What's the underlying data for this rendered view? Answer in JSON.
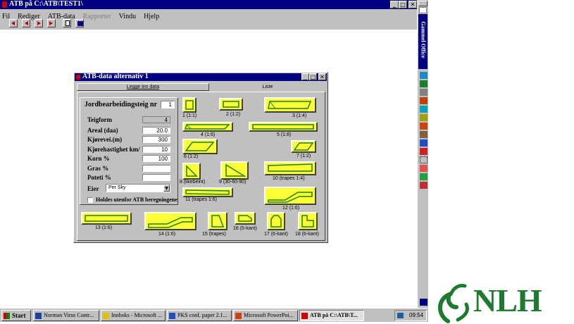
{
  "app": {
    "title": "ATB på C:\\ATB\\TEST1\\",
    "menu": [
      "Fil",
      "Rediger",
      "ATB-data",
      "Rapporter",
      "Vindu",
      "Hjelp"
    ],
    "menu_disabled_index": 3
  },
  "dialog": {
    "title": "ATB-data alternativ 1",
    "tabs": [
      "Legge inn data",
      "Liste"
    ],
    "teig_label": "Jordbearbeidingsteig nr",
    "teig_value": "1",
    "rows": [
      {
        "label": "Teigform",
        "value": "4"
      },
      {
        "label": "Areal (daa)",
        "value": "20.0"
      },
      {
        "label": "Kjørevei.(m)",
        "value": "300"
      },
      {
        "label": "Kjørehastighet km/",
        "value": "10"
      },
      {
        "label": "Korn %",
        "value": "100"
      },
      {
        "label": "Gras %",
        "value": ""
      },
      {
        "label": "Poteti %",
        "value": ""
      }
    ],
    "eier_label": "Eier",
    "eier_value": "Per Sky",
    "checkbox_label": "Holdes utenfor ATB beregningene",
    "shapes": [
      "1 (1:1)",
      "2 (1:2)",
      "3 (1:4)",
      "4 (1:6)",
      "5 (1:8)",
      "6 (1:2)",
      "7 (1:2)",
      "8 (likebeint)",
      "9 (30-60-90)",
      "10 (trapes 1:4)",
      "11 (trapes 1:6)",
      "12 (1:6)",
      "13 (1:6)",
      "14 (1:6)",
      "15 (trapes)",
      "16 (5-kant)",
      "17 (6-kant)",
      "18 (6-kant)"
    ]
  },
  "office_bar": {
    "title": "Gammel Office"
  },
  "taskbar": {
    "start": "Start",
    "tasks": [
      "Norman Virus Contr...",
      "Innboks - Microsoft ...",
      "PKS conf. paper 2.1...",
      "Microsoft PowerPoi...",
      "ATB på C:\\ATB\\T..."
    ],
    "active_index": 4,
    "clock": "09:54"
  },
  "logo": {
    "text": "NLH",
    "color": "#1e7a2e"
  },
  "colors": {
    "titlebar": "#000080",
    "shape_fill": "#ffff33",
    "shape_line": "#1a7f2a",
    "desktop": "#ffffff"
  }
}
